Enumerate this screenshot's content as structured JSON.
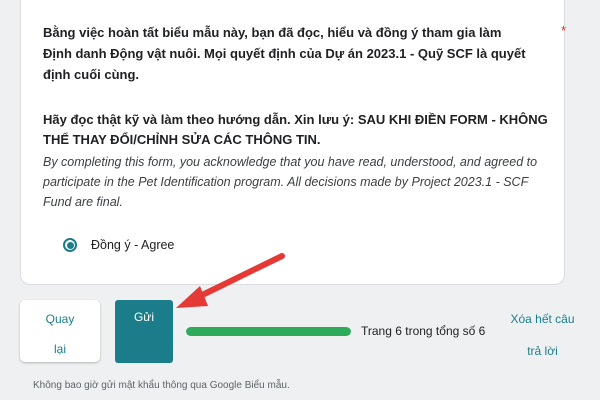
{
  "question": {
    "title": "Bằng việc hoàn tất biểu mẫu này, bạn đã đọc, hiểu và đồng ý tham gia làm Định danh Động vật nuôi. Mọi quyết định của Dự án 2023.1 - Quỹ SCF là quyết định cuối cùng.",
    "required_mark": "*",
    "note": "Hãy đọc thật kỹ và làm theo hướng dẫn. Xin lưu ý: SAU KHI ĐIỀN FORM - KHÔNG THỂ THAY ĐỔI/CHỈNH SỬA CÁC THÔNG TIN.",
    "english": "By completing this form, you acknowledge that you have read, understood, and agreed to participate in the Pet Identification program. All decisions made by Project 2023.1 - SCF Fund are final.",
    "option_label": "Đồng ý - Agree"
  },
  "nav": {
    "back_line1": "Quay",
    "back_line2": "lại",
    "submit_label": "Gửi",
    "clear_line1": "Xóa hết câu",
    "clear_line2": "trả lời"
  },
  "progress": {
    "text": "Trang 6 trong tổng số 6",
    "fraction": 1.0
  },
  "footer": {
    "note": "Không bao giờ gửi mật khẩu thông qua Google Biểu mẫu."
  },
  "colors": {
    "accent": "#1b7d8a",
    "progress": "#2eaa5b",
    "required": "#d93025",
    "annotation_arrow": "#e53935"
  }
}
